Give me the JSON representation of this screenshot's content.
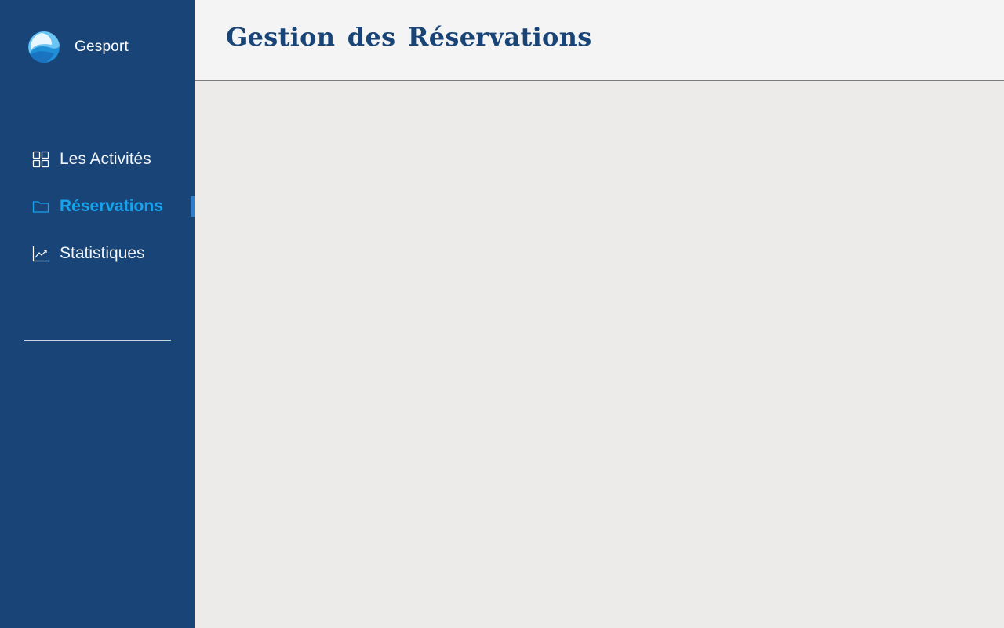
{
  "brand": {
    "name": "Gesport",
    "logo_icon": "wave-logo-icon"
  },
  "sidebar": {
    "items": [
      {
        "label": "Les Activités",
        "icon": "grid-icon",
        "active": false
      },
      {
        "label": "Réservations",
        "icon": "folder-icon",
        "active": true
      },
      {
        "label": "Statistiques",
        "icon": "chart-line-icon",
        "active": false
      }
    ]
  },
  "header": {
    "title": "Gestion des Réservations"
  },
  "colors": {
    "sidebar_bg": "#184477",
    "active_text": "#17a3ec",
    "active_indicator": "#2a7fcf",
    "title": "#184477",
    "header_bg": "#f4f4f4",
    "content_bg": "#ecebe9"
  }
}
